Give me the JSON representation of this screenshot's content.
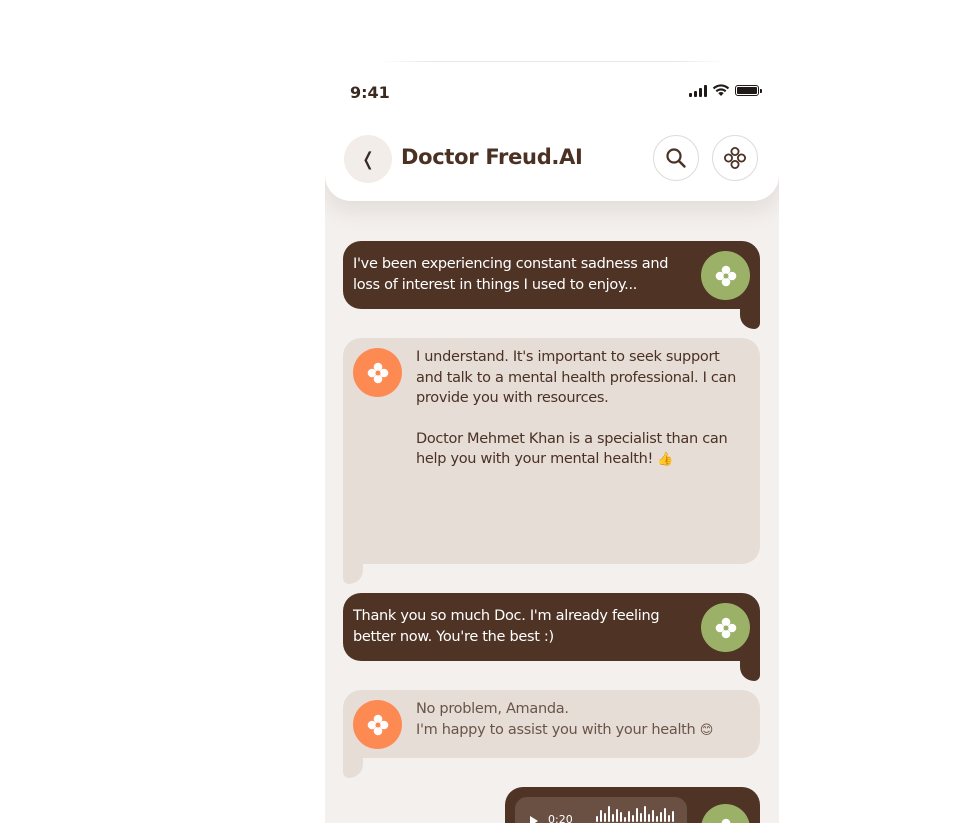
{
  "status": {
    "time": "9:41"
  },
  "header": {
    "title": "Doctor Freud.AI",
    "back_icon": "back-arrow-icon",
    "search_icon": "search-icon",
    "menu_icon": "freud-logo-icon"
  },
  "messages": [
    {
      "from": "user",
      "lines": [
        "I've been experiencing constant sadness and",
        "loss of interest in things I used to enjoy..."
      ]
    },
    {
      "from": "bot",
      "lines": [
        "I understand. It's important to seek support",
        "and talk to a mental health professional. I can",
        "provide you with resources."
      ],
      "lines2": [
        "Doctor Mehmet Khan is a specialist than can",
        "help you with your mental health!"
      ],
      "emoji2": "👍"
    },
    {
      "from": "user",
      "lines": [
        "Thank you so much Doc. I'm already feeling",
        "better now. You're the best :)"
      ]
    },
    {
      "from": "bot",
      "lines": [
        "No problem, Amanda.",
        "I'm happy to assist you with your health"
      ],
      "emoji": "😊"
    }
  ],
  "audio": {
    "duration": "0:20"
  },
  "colors": {
    "user_bubble": "#4f3426",
    "bot_bubble": "#e6ddd7",
    "user_avatar": "#9bb168",
    "bot_avatar": "#fd8a52",
    "background": "#f4f0ed"
  }
}
